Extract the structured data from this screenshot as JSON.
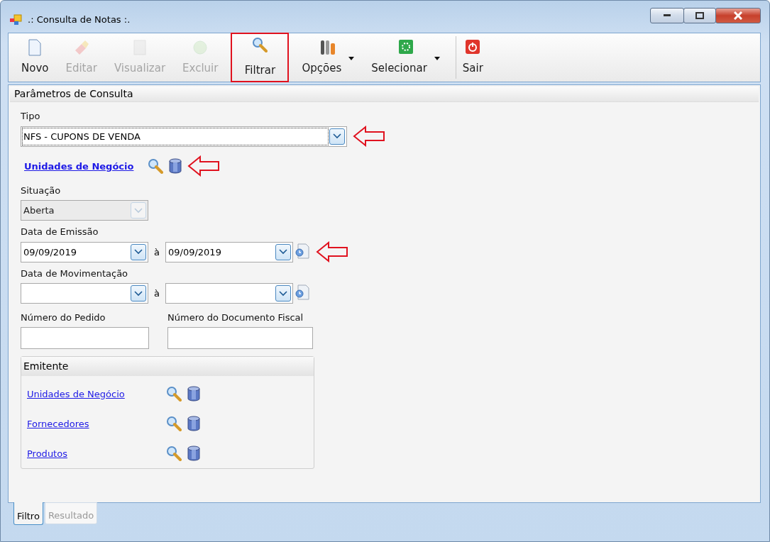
{
  "window": {
    "title": ".: Consulta de Notas :."
  },
  "toolbar": [
    {
      "label": "Novo",
      "disabled": false,
      "dropdown": false,
      "highlighted": false,
      "separator_before": false
    },
    {
      "label": "Editar",
      "disabled": true,
      "dropdown": false,
      "highlighted": false,
      "separator_before": false
    },
    {
      "label": "Visualizar",
      "disabled": true,
      "dropdown": false,
      "highlighted": false,
      "separator_before": false
    },
    {
      "label": "Excluir",
      "disabled": true,
      "dropdown": false,
      "highlighted": false,
      "separator_before": false
    },
    {
      "label": "Filtrar",
      "disabled": false,
      "dropdown": false,
      "highlighted": true,
      "separator_before": false
    },
    {
      "label": "Opções",
      "disabled": false,
      "dropdown": true,
      "highlighted": false,
      "separator_before": false
    },
    {
      "label": "Selecionar",
      "disabled": false,
      "dropdown": true,
      "highlighted": false,
      "separator_before": false
    },
    {
      "label": "Sair",
      "disabled": false,
      "dropdown": false,
      "highlighted": false,
      "separator_before": true
    }
  ],
  "panel": {
    "title": "Parâmetros de Consulta",
    "tipo": {
      "label": "Tipo",
      "value": "NFS - CUPONS DE VENDA",
      "focused": true,
      "pointer_arrow": true
    },
    "unidades": {
      "label": "Unidades de Negócio",
      "pointer_arrow": true
    },
    "situacao": {
      "label": "Situação",
      "value": "Aberta",
      "disabled": true
    },
    "data_emissao": {
      "label": "Data de Emissão",
      "from": "09/09/2019",
      "separator": "à",
      "to": "09/09/2019",
      "pointer_arrow": true
    },
    "data_movimentacao": {
      "label": "Data de Movimentação",
      "separator": "à"
    },
    "numero_pedido": {
      "label": "Número do Pedido"
    },
    "numero_documento": {
      "label": "Número do Documento Fiscal"
    },
    "emitente": {
      "title": "Emitente",
      "links": [
        "Unidades de Negócio",
        "Fornecedores",
        "Produtos"
      ]
    }
  },
  "tabs": [
    {
      "label": "Filtro",
      "selected": true
    },
    {
      "label": "Resultado",
      "selected": false
    }
  ]
}
